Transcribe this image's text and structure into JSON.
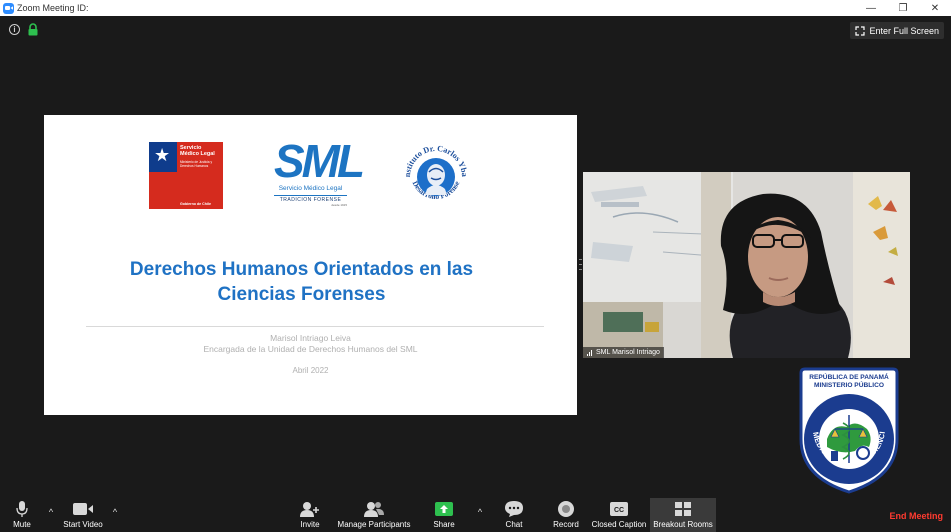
{
  "window": {
    "title": "Zoom Meeting ID:",
    "controls": [
      "—",
      "❐",
      "✕"
    ]
  },
  "top_bar": {
    "fullscreen_label": "Enter Full Screen"
  },
  "slide": {
    "logo_chile": {
      "line1": "Servicio Médico Legal",
      "line2": "Ministerio de Justicia y Derechos Humanos",
      "footer": "Gobierno de Chile"
    },
    "logo_sml": {
      "acronym": "SML",
      "name": "Servicio Médico Legal",
      "tagline": "TRADICION FORENSE",
      "since": "desde 1915"
    },
    "logo_institute": {
      "text_top": "Instituto Dr. Carlos Ybar",
      "text_bottom": "Desarrollo Forense"
    },
    "title_line1": "Derechos Humanos Orientados en las",
    "title_line2": "Ciencias Forenses",
    "author": "Marisol Intriago Leiva",
    "role": "Encargada de la Unidad de Derechos Humanos del SML",
    "date": "Abril 2022"
  },
  "video": {
    "participant_name": "SML Marisol Intriago"
  },
  "overlay_logo": {
    "line1": "REPÚBLICA DE PANAMÁ",
    "line2": "MINISTERIO PÚBLICO",
    "ring_text": "INSTITUTO DE MEDICINA LEGAL Y CIENCIAS FORENSES"
  },
  "toolbar": {
    "mute": "Mute",
    "start_video": "Start Video",
    "invite": "Invite",
    "manage_participants": "Manage Participants",
    "share": "Share",
    "chat": "Chat",
    "record": "Record",
    "closed_caption": "Closed Caption",
    "breakout_rooms": "Breakout Rooms",
    "end_meeting": "End Meeting"
  },
  "colors": {
    "background": "#1a1a1a",
    "slide_title": "#1f72c4",
    "end_meeting": "#ff3b30",
    "share_green": "#2ec04f",
    "zoom_blue": "#2d8cff"
  }
}
